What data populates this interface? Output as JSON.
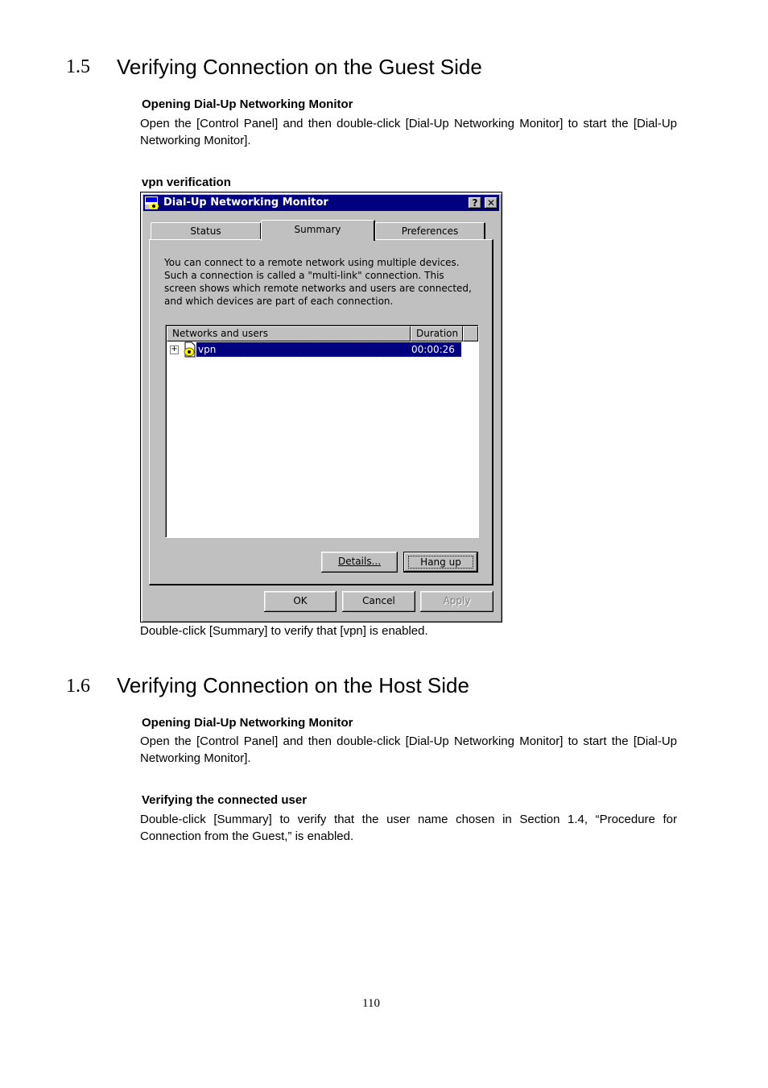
{
  "section_1_5": {
    "number": "1.5",
    "title": "Verifying Connection on the Guest Side",
    "subheading": "Opening Dial-Up Networking Monitor",
    "paragraph": "Open the [Control Panel] and then double-click [Dial-Up Networking Monitor] to start the [Dial-Up Networking Monitor].",
    "figure_label": "vpn verification",
    "caption": "Double-click [Summary] to verify that [vpn] is enabled."
  },
  "dialog": {
    "title": "Dial-Up Networking Monitor",
    "help_button": "?",
    "close_button": "✕",
    "tabs": [
      {
        "label": "Status",
        "active": false
      },
      {
        "label": "Summary",
        "active": true
      },
      {
        "label": "Preferences",
        "active": false
      }
    ],
    "description": "You can connect to a remote network using multiple devices. Such a connection is called a \"multi-link\" connection. This screen shows which remote networks and users are connected, and which devices are part of each connection.",
    "list": {
      "columns": [
        "Networks and users",
        "Duration"
      ],
      "rows": [
        {
          "expander": "+",
          "icon": "dialup-connection-icon",
          "name": "vpn",
          "duration": "00:00:26",
          "selected": true
        }
      ]
    },
    "buttons": {
      "details": "Details...",
      "hang_up": "Hang up",
      "ok": "OK",
      "cancel": "Cancel",
      "apply": "Apply"
    },
    "colors": {
      "titlebar": "#000080",
      "face": "#c0c0c0",
      "selection": "#000080"
    }
  },
  "section_1_6": {
    "number": "1.6",
    "title": "Verifying Connection on the Host Side",
    "subheading": "Opening Dial-Up Networking Monitor",
    "paragraph": "Open the [Control Panel] and then double-click [Dial-Up Networking Monitor] to start the [Dial-Up Networking Monitor].",
    "subheading2": "Verifying the connected user",
    "paragraph2": "Double-click [Summary] to verify that the user name chosen in Section 1.4, “Procedure for Connection from the Guest,” is enabled."
  },
  "page_number": "110"
}
